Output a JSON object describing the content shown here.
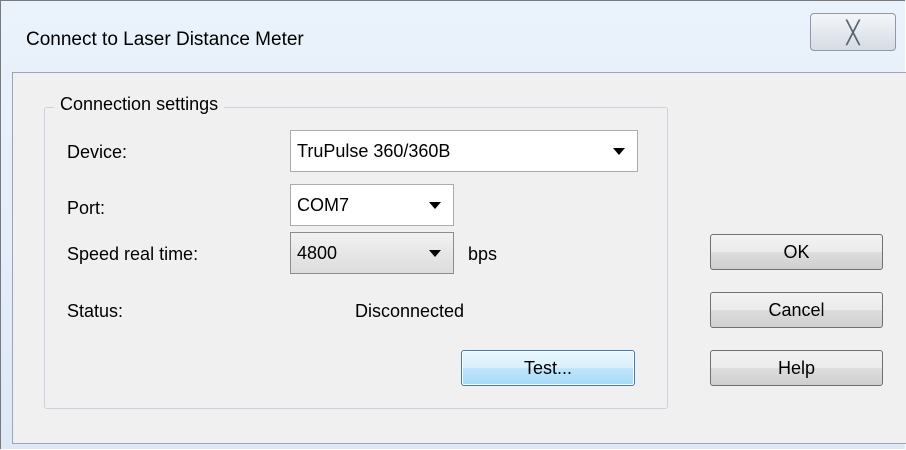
{
  "window": {
    "title": "Connect to Laser Distance Meter",
    "close_glyph": "╳"
  },
  "group": {
    "legend": "Connection settings"
  },
  "fields": {
    "device_label": "Device:",
    "device_value": "TruPulse 360/360B",
    "port_label": "Port:",
    "port_value": "COM7",
    "speed_label": "Speed real time:",
    "speed_value": "4800",
    "speed_unit": "bps",
    "status_label": "Status:",
    "status_value": "Disconnected"
  },
  "buttons": {
    "test": "Test...",
    "ok": "OK",
    "cancel": "Cancel",
    "help": "Help"
  },
  "icons": {
    "close": "close-icon",
    "dropdown": "chevron-down-icon"
  }
}
